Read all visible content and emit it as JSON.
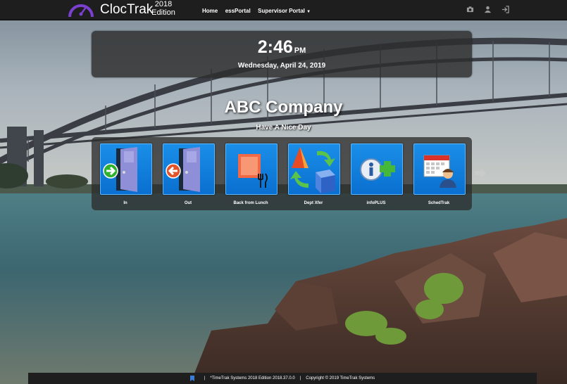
{
  "navbar": {
    "brand": "ClocTrak",
    "edition_year": "2018",
    "edition_word": "Edition",
    "links": [
      "Home",
      "essPortal",
      "Supervisor Portal"
    ],
    "icons": [
      "camera-icon",
      "user-icon",
      "sign-out-icon"
    ]
  },
  "clock": {
    "time": "2:46",
    "ampm": "PM",
    "date": "Wednesday, April 24, 2019"
  },
  "company": {
    "name": "ABC Company",
    "greeting": "Have A Nice Day"
  },
  "actions": [
    {
      "label": "In",
      "icon": "door-in-icon"
    },
    {
      "label": "Out",
      "icon": "door-out-icon"
    },
    {
      "label": "Back from Lunch",
      "icon": "lunch-icon"
    },
    {
      "label": "Dept Xfer",
      "icon": "transfer-icon"
    },
    {
      "label": "infoPLUS",
      "icon": "info-plus-icon"
    },
    {
      "label": "SchedTrak",
      "icon": "schedule-icon"
    }
  ],
  "footer": {
    "version": "*TimeTrak Systems 2018 Edition 2018.37.0.0",
    "copyright": "Copyright © 2019 TimeTrak Systems",
    "separator": "|"
  },
  "colors": {
    "navbar": "#1e1e1e",
    "tile": "#1a8fe8",
    "logo_purple": "#7b3fd1"
  }
}
